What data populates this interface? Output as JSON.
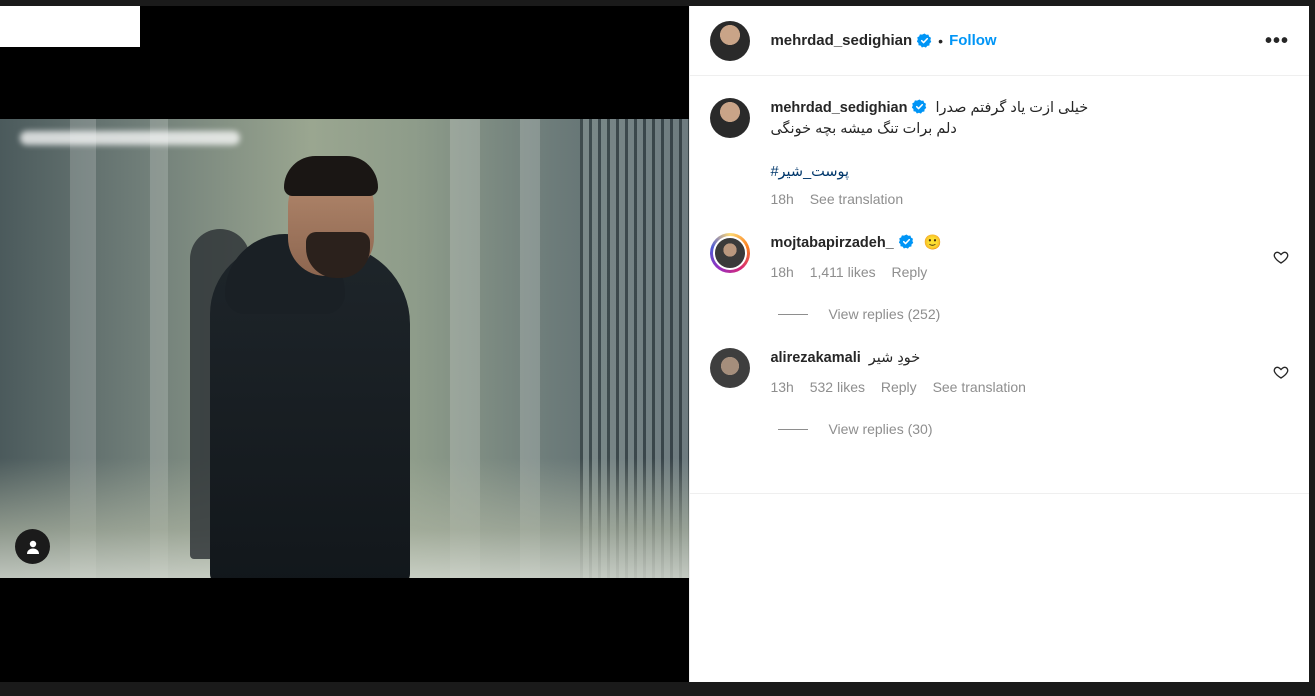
{
  "header": {
    "username": "mehrdad_sedighian",
    "dot": "•",
    "follow_label": "Follow",
    "more_label": "•••"
  },
  "caption": {
    "username": "mehrdad_sedighian",
    "text_line1": "خیلی ازت یاد گرفتم صدرا",
    "text_line2": "دلم برات تنگ میشه بچه خونگی",
    "hashtag": "#پوست_شیر",
    "time": "18h",
    "see_translation": "See translation"
  },
  "comments": [
    {
      "username": "mojtabapirzadeh_",
      "verified": true,
      "text": "🙂",
      "time": "18h",
      "likes": "1,411 likes",
      "reply": "Reply",
      "view_replies": "View replies (252)"
    },
    {
      "username": "alirezakamali",
      "verified": false,
      "text": "خودِ شیر",
      "time": "13h",
      "likes": "532 likes",
      "reply": "Reply",
      "see_translation": "See translation",
      "view_replies": "View replies (30)"
    }
  ],
  "colors": {
    "follow": "#0095f6",
    "verified": "#0095f6",
    "muted": "#8e8e8e",
    "hashtag": "#00376b"
  },
  "icons": {
    "verified": "verified-badge-icon",
    "heart": "heart-outline-icon",
    "user_tag": "user-tag-icon",
    "more": "more-horizontal-icon"
  }
}
